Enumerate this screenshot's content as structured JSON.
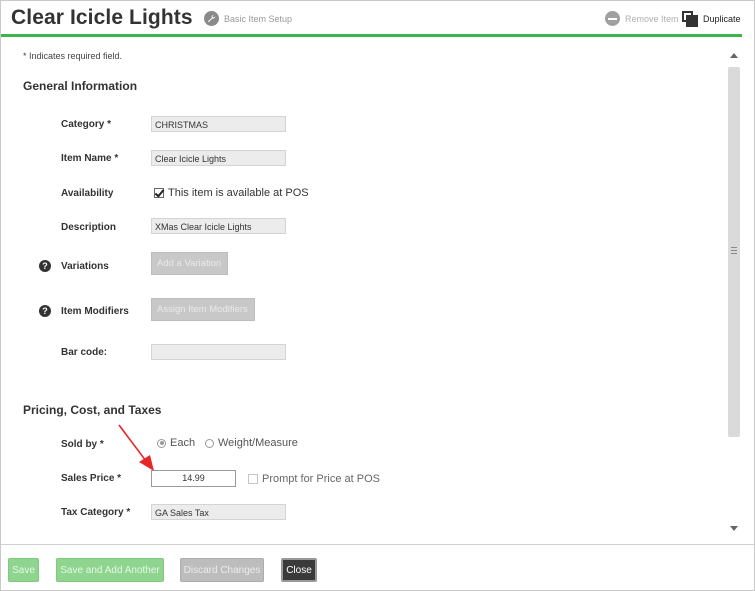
{
  "header": {
    "title": "Clear Icicle Lights",
    "basic_setup": "Basic Item Setup",
    "remove_item": "Remove Item",
    "duplicate": "Duplicate"
  },
  "form": {
    "required_note": "* Indicates required field.",
    "general_section": "General Information",
    "category_label": "Category *",
    "category_value": "CHRISTMAS",
    "item_name_label": "Item Name *",
    "item_name_value": "Clear Icicle Lights",
    "availability_label": "Availability",
    "availability_checkbox_label": "This item is available at POS",
    "description_label": "Description",
    "description_value": "XMas Clear Icicle Lights",
    "variations_label": "Variations",
    "add_variation_button": "Add a Variation",
    "item_modifiers_label": "Item Modifiers",
    "assign_modifiers_button": "Assign Item Modifiers",
    "barcode_label": "Bar code:",
    "barcode_value": "",
    "pricing_section": "Pricing, Cost, and Taxes",
    "sold_by_label": "Sold by *",
    "sold_by_each": "Each",
    "sold_by_weight": "Weight/Measure",
    "sales_price_label": "Sales Price *",
    "sales_price_value": "14.99",
    "prompt_price_label": "Prompt for Price at POS",
    "tax_category_label": "Tax Category *",
    "tax_category_value": "GA Sales Tax",
    "help_glyph": "?"
  },
  "footer": {
    "save": "Save",
    "save_add_another": "Save and Add Another",
    "discard_changes": "Discard Changes",
    "close": "Close"
  },
  "colors": {
    "accent_green": "#3cb54a",
    "annotation_red": "#e8262a"
  }
}
